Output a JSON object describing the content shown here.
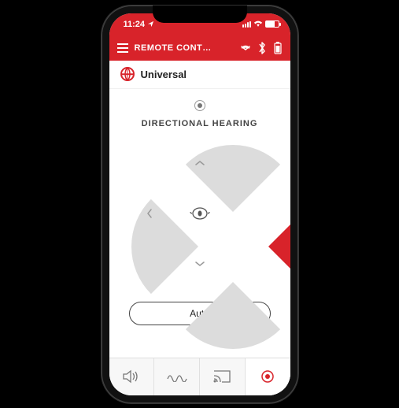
{
  "colors": {
    "accent": "#d8232a",
    "neutral": "#dcdcdc"
  },
  "status_bar": {
    "time": "11:24"
  },
  "header": {
    "title": "REMOTE CONT…",
    "icons": [
      "menu",
      "dropdown",
      "bluetooth",
      "battery"
    ]
  },
  "program": {
    "icon": "globe",
    "name": "Universal"
  },
  "content": {
    "section_title": "DIRECTIONAL HEARING",
    "selected_direction": "right",
    "auto_label": "Auto"
  },
  "tabs": {
    "items": [
      "volume",
      "equalizer",
      "stream",
      "direction"
    ],
    "active_index": 3
  }
}
